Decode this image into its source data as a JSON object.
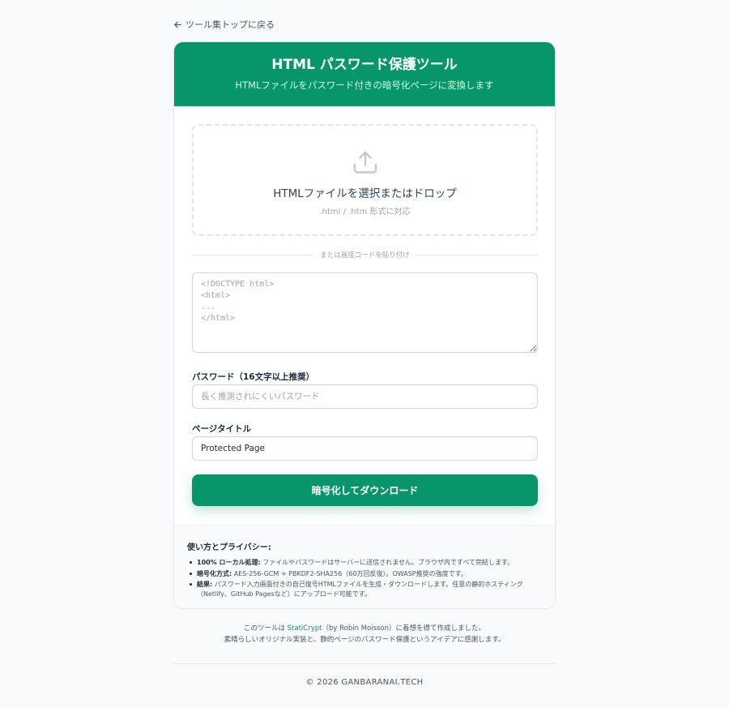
{
  "back_link": {
    "label": "ツール集トップに戻る",
    "icon": "arrow-left-icon"
  },
  "header": {
    "title": "HTML パスワード保護ツール",
    "subtitle": "HTMLファイルをパスワード付きの暗号化ページに変換します"
  },
  "dropzone": {
    "icon": "upload-icon",
    "title": "HTMLファイルを選択またはドロップ",
    "subtitle": ".html / .htm 形式に対応"
  },
  "divider": {
    "label": "または直接コードを貼り付け"
  },
  "code_input": {
    "value": "",
    "placeholder": "<!DOCTYPE html>\n<html>\n...\n</html>"
  },
  "password": {
    "label": "パスワード（16文字以上推奨）",
    "value": "",
    "placeholder": "長く推測されにくいパスワード"
  },
  "page_title": {
    "label": "ページタイトル",
    "value": "Protected Page",
    "placeholder": ""
  },
  "submit": {
    "label": "暗号化してダウンロード"
  },
  "info": {
    "heading": "使い方とプライバシー:",
    "items": [
      {
        "strong": "100% ローカル処理:",
        "text": " ファイルやパスワードはサーバーに送信されません。ブラウザ内ですべて完結します。"
      },
      {
        "strong": "暗号化方式:",
        "text": " AES-256-GCM + PBKDF2-SHA256（60万回反復）。OWASP推奨の強度です。"
      },
      {
        "strong": "結果:",
        "text": " パスワード入力画面付きの自己復号HTMLファイルを生成・ダウンロードします。任意の静的ホスティング（Netlify、GitHub Pagesなど）にアップロード可能です。"
      }
    ]
  },
  "credit": {
    "prefix": "このツールは ",
    "link": "StatiCrypt",
    "suffix": "（by Robin Moisson）に着想を得て作成しました。",
    "line2": "素晴らしいオリジナル実装と、静的ページのパスワード保護というアイデアに感謝します。"
  },
  "footer": {
    "copyright": "© 2026 GANBARANAI.TECH"
  },
  "colors": {
    "accent": "#079669",
    "background": "#f8f9fb"
  }
}
